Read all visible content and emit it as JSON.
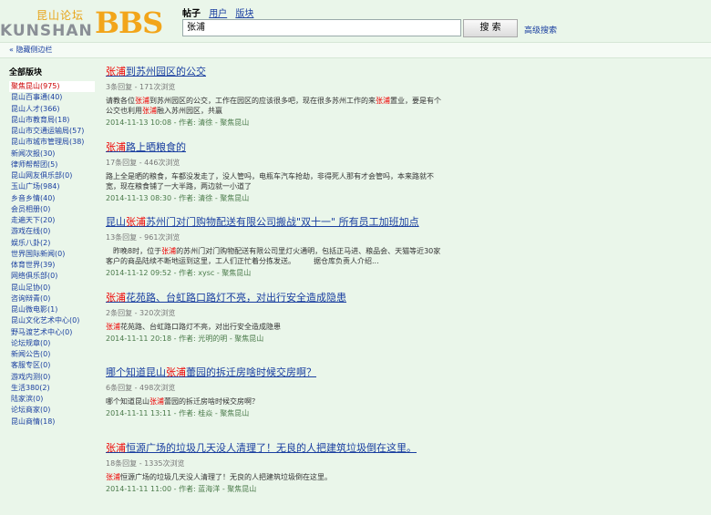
{
  "header": {
    "logo_cn": "昆山论坛",
    "logo_en": "KUNSHAN",
    "logo_bbs": "BBS",
    "tabs": [
      {
        "label": "帖子",
        "active": true
      },
      {
        "label": "用户",
        "active": false
      },
      {
        "label": "版块",
        "active": false
      }
    ],
    "search_value": "张浦",
    "search_button": "搜 索",
    "advanced_search": "高级搜索"
  },
  "hide_bar": "« 隐藏侧边栏",
  "sidebar": {
    "title": "全部版块",
    "items": [
      "聚焦昆山(975)",
      "昆山百事通(40)",
      "昆山人才(366)",
      "昆山市教育局(18)",
      "昆山市交通运输局(57)",
      "昆山市城市管理局(38)",
      "新闻次报(30)",
      "律师帮帮团(5)",
      "昆山网友俱乐部(0)",
      "玉山广场(984)",
      "乡音乡情(40)",
      "会员相册(0)",
      "走遍天下(20)",
      "游戏在线(0)",
      "娱乐八卦(2)",
      "世界国际新闻(0)",
      "体育世界(39)",
      "网络俱乐部(0)",
      "昆山足协(0)",
      "咨询辩青(0)",
      "昆山微电影(1)",
      "昆山文化艺术中心(0)",
      "野马渡艺术中心(0)",
      "论坛规章(0)",
      "新闻公告(0)",
      "客服专区(0)",
      "游戏内测(0)",
      "生活380(2)",
      "陆家滨(0)",
      "论坛商家(0)",
      "昆山商情(18)"
    ],
    "selected": 0
  },
  "results": [
    {
      "title": [
        {
          "t": "张浦",
          "hl": true
        },
        {
          "t": "到苏州园区的公交",
          "hl": false
        }
      ],
      "meta": "3条回复 - 171次浏览",
      "snippet": [
        {
          "t": "请教各位",
          "hl": false
        },
        {
          "t": "张浦",
          "hl": true
        },
        {
          "t": "到苏州园区的公交，工作在园区的应该很多吧，现在很多苏州工作的来",
          "hl": false
        },
        {
          "t": "张浦",
          "hl": true
        },
        {
          "t": "置业，要是有个公交也利用",
          "hl": false
        },
        {
          "t": "张浦",
          "hl": true
        },
        {
          "t": "融入苏州园区，共赢",
          "hl": false
        }
      ],
      "info": "2014-11-13 10:08 - 作者: 清徐 - 聚焦昆山"
    },
    {
      "title": [
        {
          "t": "张浦",
          "hl": true
        },
        {
          "t": "路上晒粮食的",
          "hl": false
        }
      ],
      "meta": "17条回复 - 446次浏览",
      "snippet": [
        {
          "t": "路上全是晒的粮食，车都没发走了，没人管吗，电瓶车汽车抢劫，非得死人那有才会管吗，本来路就不宽，现在粮食铺了一大半路，两边就一小道了",
          "hl": false
        }
      ],
      "info": "2014-11-13 08:30 - 作者: 清徐 - 聚焦昆山"
    },
    {
      "title": [
        {
          "t": "昆山",
          "hl": false
        },
        {
          "t": "张浦",
          "hl": true
        },
        {
          "t": "苏州门对门购物配送有限公司搬战\"双十一\" 所有员工加班加点",
          "hl": false
        }
      ],
      "meta": "13条回复 - 961次浏览",
      "snippet": [
        {
          "t": "　昨晚8时，位于",
          "hl": false
        },
        {
          "t": "张浦",
          "hl": true
        },
        {
          "t": "的苏州门对门购物配送有限公司里灯火通明，包括正马进、粮品会、天猫等近30家客户的商品陆续不断地运到这里，工人们正忙着分拣发送。　　　据仓库负责人介绍...",
          "hl": false
        }
      ],
      "info": "2014-11-12 09:52 - 作者: xysc - 聚焦昆山"
    },
    {
      "title": [
        {
          "t": "张浦",
          "hl": true
        },
        {
          "t": "花苑路、台虹路口路灯不亮，对出行安全造成隐患",
          "hl": false
        }
      ],
      "meta": "2条回复 - 320次浏览",
      "snippet": [
        {
          "t": "张浦",
          "hl": true
        },
        {
          "t": "花苑路、台虹路口路灯不亮，对出行安全造成隐患",
          "hl": false
        }
      ],
      "info": "2014-11-11 20:18 - 作者: 光明的明 - 聚焦昆山"
    },
    {
      "title": [
        {
          "t": "哪个知道昆山",
          "hl": false
        },
        {
          "t": "张浦",
          "hl": true
        },
        {
          "t": "蕾园的拆迁房啥时候交房啊？",
          "hl": false
        }
      ],
      "meta": "6条回复 - 498次浏览",
      "snippet": [
        {
          "t": "哪个知道昆山",
          "hl": false
        },
        {
          "t": "张浦",
          "hl": true
        },
        {
          "t": "蕾园的拆迁房啥时候交房啊？",
          "hl": false
        }
      ],
      "info": "2014-11-11 13:11 - 作者: 桂焱 - 聚焦昆山"
    },
    {
      "title": [
        {
          "t": "张浦",
          "hl": true
        },
        {
          "t": "恒源广场的垃圾几天没人清理了！无良的人把建筑垃圾倒在这里。",
          "hl": false
        }
      ],
      "meta": "18条回复 - 1335次浏览",
      "snippet": [
        {
          "t": "张浦",
          "hl": true
        },
        {
          "t": "恒源广场的垃圾几天没人清理了！无良的人把建筑垃圾倒在这里。",
          "hl": false
        }
      ],
      "info": "2014-11-11 11:00 - 作者: 蓝海洋 - 聚焦昆山"
    }
  ]
}
